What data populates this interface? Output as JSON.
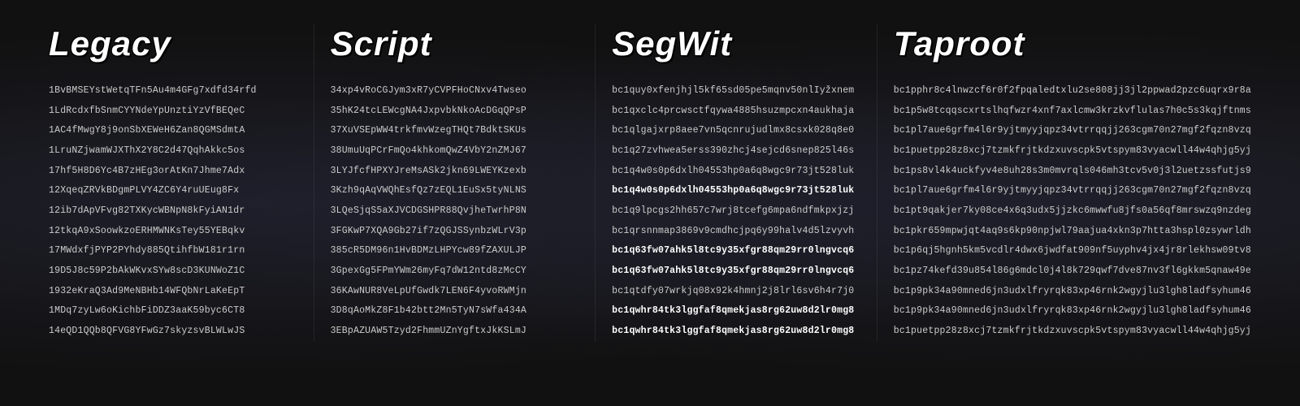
{
  "columns": [
    {
      "id": "legacy",
      "title": "Legacy",
      "addresses": [
        "1BvBMSEYstWetqTFn5Au4m4GFg7xdfd34rfd",
        "1LdRcdxfbSnmCYYNdeYpUnztiYzVfBEQeC",
        "1AC4fMwgY8j9onSbXEWeH6Zan8QGMSdmtA",
        "1LruNZjwamWJXThX2Y8C2d47QqhAkkc5os",
        "17hf5H8D6Yc4B7zHEg3orAtKn7Jhme7Adx",
        "12XqeqZRVkBDgmPLVY4ZC6Y4ruUEug8Fx",
        "12ib7dApVFvg82TXKycWBNpN8kFyiAN1dr",
        "12tkqA9xSoowkzoERHMWNKsTey55YEBqkv",
        "17MWdxfjPYP2PYhdy885QtihfbW181r1rn",
        "19D5J8c59P2bAkWKvxSYw8scD3KUNWoZ1C",
        "1932eKraQ3Ad9MeNBHb14WFQbNrLaKeEpT",
        "1MDq7zyLw6oKichbFiDDZ3aaK59byc6CT8",
        "14eQD1QQb8QFVG8YFwGz7skyzsvBLWLwJS"
      ]
    },
    {
      "id": "script",
      "title": "Script",
      "addresses": [
        "34xp4vRoCGJym3xR7yCVPFHoCNxv4Twseo",
        "35hK24tcLEWcgNA4JxpvbkNkoAcDGqQPsP",
        "37XuVSEpWW4trkfmvWzegTHQt7BdktSKUs",
        "38UmuUqPCrFmQo4khkomQwZ4VbY2nZMJ67",
        "3LYJfcfHPXYJreMsASk2jkn69LWEYKzexb",
        "3Kzh9qAqVWQhEsfQz7zEQL1EuSx5tyNLNS",
        "3LQeSjqS5aXJVCDGSHPR88QvjheTwrhP8N",
        "3FGKwP7XQA9Gb27if7zQGJSSynbzWLrV3p",
        "385cR5DM96n1HvBDMzLHPYcw89fZAXULJP",
        "3GpexGg5FPmYWm26myFq7dW12ntd8zMcCY",
        "36KAwNUR8VeLpUfGwdk7LEN6F4yvoRWMjn",
        "3D8qAoMkZ8F1b42btt2Mn5TyN7sWfa434A",
        "3EBpAZUAW5Tzyd2FhmmUZnYgftxJkKSLmJ"
      ]
    },
    {
      "id": "segwit",
      "title": "SegWit",
      "addresses": [
        "bc1quy0xfenjhjl5kf65sd05pe5mqnv50nlIyžxnem",
        "bc1qxclc4prcwsctfqywa4885hsuzmpcxn4aukhaja",
        "bc1qlgajxrp8aee7vn5qcnrujudlmx8csxk028q8e0",
        "bc1q27zvhwea5erss390zhcj4sejcd6snep825l46s",
        "bc1q4w0s0p6dxlh04553hp0a6q8wgc9r73jt528luk",
        "bc1q4w0s0p6dxlh04553hp0a6q8wgc9r73jt528luk",
        "bc1q9lpcgs2hh657c7wrj8tcefg6mpa6ndfmkpxjzj",
        "bc1qrsnnmap3869v9cmdhcjpq6y99halv4d5lzvyvh",
        "bc1q63fw07ahk5l8tc9y35xfgr88qm29rr0lngvcq6",
        "bc1q63fw07ahk5l8tc9y35xfgr88qm29rr0lngvcq6",
        "bc1qtdfy07wrkjq08x92k4hmnj2j8lrl6sv6h4r7j0",
        "bc1qwhr84tk3lggfaf8qmekjas8rg62uw8d2lr0mg8",
        "bc1qwhr84tk3lggfaf8qmekjas8rg62uw8d2lr0mg8"
      ],
      "highlights": [
        5,
        8,
        9,
        11,
        12
      ]
    },
    {
      "id": "taproot",
      "title": "Taproot",
      "addresses": [
        "bc1pphr8c4lnwzcf6r0f2fpqaledtxlu2se808jj3jl2ppwad2pzc6uqrx9r8a",
        "bc1p5w8tcqqscxrtslhqfwzr4xnf7axlcmw3krzkvflulas7h0c5s3kqjftnms",
        "bc1pl7aue6grfm4l6r9yjtmyyjqpz34vtrrqqjj263cgm70n27mgf2fqzn8vzq",
        "bc1puetpp28z8xcj7tzmkfrjtkdzxuvscpk5vtspym83vyacwll44w4qhjg5yj",
        "bc1ps8vl4k4uckfyv4e8uh28s3m0mvrqls046mh3tcv5v0j3l2uetzssfutjs9",
        "bc1pl7aue6grfm4l6r9yjtmyyjqpz34vtrrqqjj263cgm70n27mgf2fqzn8vzq",
        "bc1pt9qakjer7ky08ce4x6q3udx5jjzkc6mwwfu8jfs0a56qf8mrswzq9nzdeg",
        "bc1pkr659mpwjqt4aq9s6kp90npjwl79aajua4xkn3p7htta3hspl0zsywrldh",
        "bc1p6qj5hgnh5km5vcdlr4dwx6jwdfat909nf5uyphv4jx4jr8rlekhsw09tv8",
        "bc1pz74kefd39u854l86g6mdcl0j4l8k729qwf7dve87nv3fl6gkkm5qnaw49e",
        "bc1p9pk34a90mned6jn3udxlfryrqk83xp46rnk2wgyjlu3lgh8ladfsyhum46",
        "bc1p9pk34a90mned6jn3udxlfryrqk83xp46rnk2wgyjlu3lgh8ladfsyhum46",
        "bc1puetpp28z8xcj7tzmkfrjtkdzxuvscpk5vtspym83vyacwll44w4qhjg5yj"
      ]
    }
  ]
}
